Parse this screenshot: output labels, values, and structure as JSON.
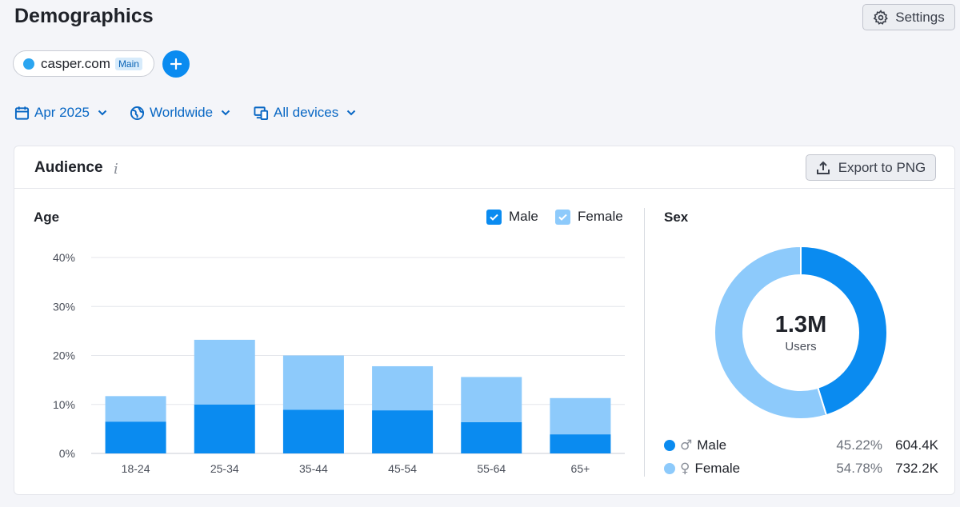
{
  "page": {
    "title": "Demographics",
    "settings_label": "Settings"
  },
  "domain": {
    "name": "casper.com",
    "badge": "Main",
    "color": "#2ba5f0"
  },
  "filters": {
    "date": "Apr 2025",
    "region": "Worldwide",
    "devices": "All devices"
  },
  "card": {
    "title": "Audience",
    "info_icon": "i",
    "export_label": "Export to PNG"
  },
  "age": {
    "title": "Age",
    "legend": [
      {
        "name": "Male",
        "color": "#0a8bf0"
      },
      {
        "name": "Female",
        "color": "#8dcafb"
      }
    ]
  },
  "sex": {
    "title": "Sex",
    "total": "1.3M",
    "total_label": "Users",
    "rows": [
      {
        "label": "Male",
        "symbol": "♂",
        "pct": "45.22%",
        "value": "604.4K",
        "color": "#0a8bf0"
      },
      {
        "label": "Female",
        "symbol": "♀",
        "pct": "54.78%",
        "value": "732.2K",
        "color": "#8dcafb"
      }
    ]
  },
  "chart_data": [
    {
      "type": "bar",
      "stacked": true,
      "title": "Age",
      "categories": [
        "18-24",
        "25-34",
        "35-44",
        "45-54",
        "55-64",
        "65+"
      ],
      "series": [
        {
          "name": "Male",
          "values": [
            6.5,
            10,
            8.9,
            8.8,
            6.4,
            3.9
          ],
          "color": "#0a8bf0"
        },
        {
          "name": "Female",
          "values": [
            5.2,
            13.2,
            11.1,
            9,
            9.2,
            7.4
          ],
          "color": "#8dcafb"
        }
      ],
      "yticks": [
        "0%",
        "10%",
        "20%",
        "30%",
        "40%"
      ],
      "ylim": [
        0,
        40
      ],
      "grid": true,
      "legend": "top-right"
    },
    {
      "type": "pie",
      "title": "Sex",
      "labels": [
        "Male",
        "Female"
      ],
      "values": [
        45.22,
        54.78
      ],
      "colors": [
        "#0a8bf0",
        "#8dcafb"
      ]
    }
  ]
}
